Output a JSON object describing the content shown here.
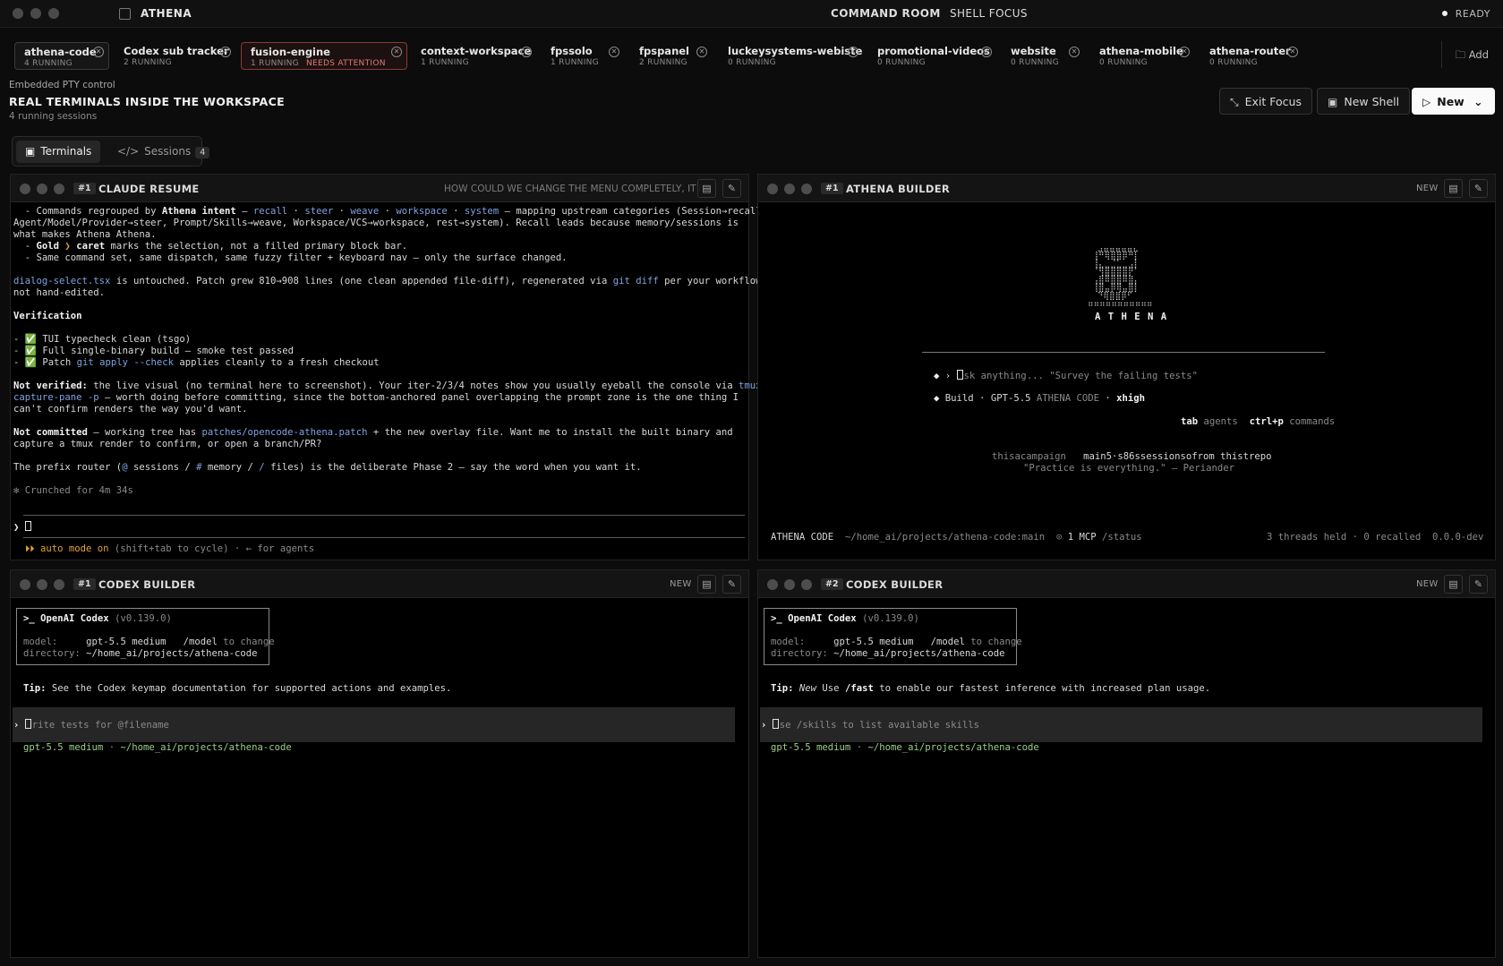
{
  "titlebar": {
    "app_name": "ATHENA",
    "view_primary": "COMMAND ROOM",
    "view_secondary": "SHELL FOCUS",
    "status": "READY"
  },
  "projects": [
    {
      "name": "athena-code",
      "count": "4 RUNNING",
      "warn": ""
    },
    {
      "name": "Codex sub tracker",
      "count": "2 RUNNING",
      "warn": ""
    },
    {
      "name": "fusion-engine",
      "count": "1 RUNNING",
      "warn": "NEEDS ATTENTION"
    },
    {
      "name": "context-workspace",
      "count": "1 RUNNING",
      "warn": ""
    },
    {
      "name": "fpssolo",
      "count": "1 RUNNING",
      "warn": ""
    },
    {
      "name": "fpspanel",
      "count": "2 RUNNING",
      "warn": ""
    },
    {
      "name": "luckeysystems-webiste",
      "count": "0 RUNNING",
      "warn": ""
    },
    {
      "name": "promotional-videos",
      "count": "0 RUNNING",
      "warn": ""
    },
    {
      "name": "website",
      "count": "0 RUNNING",
      "warn": ""
    },
    {
      "name": "athena-mobile",
      "count": "0 RUNNING",
      "warn": ""
    },
    {
      "name": "athena-router",
      "count": "0 RUNNING",
      "warn": ""
    }
  ],
  "add_label": "Add",
  "header": {
    "eyebrow": "Embedded PTY control",
    "title": "REAL TERMINALS INSIDE THE WORKSPACE",
    "count": "4 running sessions",
    "exit_focus": "Exit Focus",
    "new_shell": "New Shell",
    "new": "New"
  },
  "view_tabs": {
    "terminals": "Terminals",
    "sessions": "Sessions",
    "sessions_count": "4"
  },
  "panes": {
    "p1": {
      "num": "#1",
      "title": "CLAUDE RESUME",
      "summary": "HOW COULD WE CHANGE THE MENU COMPLETELY, IT RE..."
    },
    "p2": {
      "num": "#1",
      "title": "ATHENA BUILDER",
      "badge": "NEW"
    },
    "p3": {
      "num": "#1",
      "title": "CODEX BUILDER",
      "badge": "NEW"
    },
    "p4": {
      "num": "#2",
      "title": "CODEX BUILDER",
      "badge": "NEW"
    }
  },
  "claude": {
    "crunched": "✻ Crunched for 4m 34s",
    "mode": "⏵⏵ auto mode on",
    "mode_hint": " (shift+tab to cycle) · ← for agents"
  },
  "athena_term": {
    "logo_text": "A T H E N A",
    "input_placeholder": "sk anything... \"Survey the failing tests\"",
    "mode": "Build",
    "model": "GPT-5.5",
    "harness": "ATHENA CODE",
    "effort": "xhigh",
    "hint_tab": "tab",
    "hint_tab_label": "agents",
    "hint_ctrl": "ctrl+p",
    "hint_ctrl_label": "commands",
    "campaign": "thisacampaign",
    "repo": "main5·s86ssessionsofrom thistrepo",
    "quote": "\"Practice is everything.\" — Periander",
    "footer_name": "ATHENA CODE",
    "footer_path": "~/home_ai/projects/athena-code:main",
    "footer_mcp": "1 MCP",
    "footer_status": "/status",
    "footer_right": "3 threads held · 0 recalled  0.0.0-dev"
  },
  "codex1": {
    "title": ">_ OpenAI Codex",
    "version": "(v0.139.0)",
    "model_label": "model:",
    "model": "gpt-5.5 medium",
    "model_cmd": "/model",
    "model_hint": "to change",
    "dir_label": "directory:",
    "dir": "~/home_ai/projects/athena-code",
    "tip_label": "Tip:",
    "tip": " See the Codex keymap documentation for supported actions and examples.",
    "placeholder": "rite tests for @filename",
    "status_model": "gpt-5.5 medium",
    "status_path": "~/home_ai/projects/athena-code"
  },
  "codex2": {
    "title": ">_ OpenAI Codex",
    "version": "(v0.139.0)",
    "model_label": "model:",
    "model": "gpt-5.5 medium",
    "model_cmd": "/model",
    "model_hint": "to change",
    "dir_label": "directory:",
    "dir": "~/home_ai/projects/athena-code",
    "tip_label": "Tip:",
    "tip_new": "New",
    "tip_pre": " Use ",
    "tip_cmd": "/fast",
    "tip_post": " to enable our fastest inference with increased plan usage.",
    "placeholder": "se /skills to list available skills",
    "status_model": "gpt-5.5 medium",
    "status_path": "~/home_ai/projects/athena-code"
  }
}
